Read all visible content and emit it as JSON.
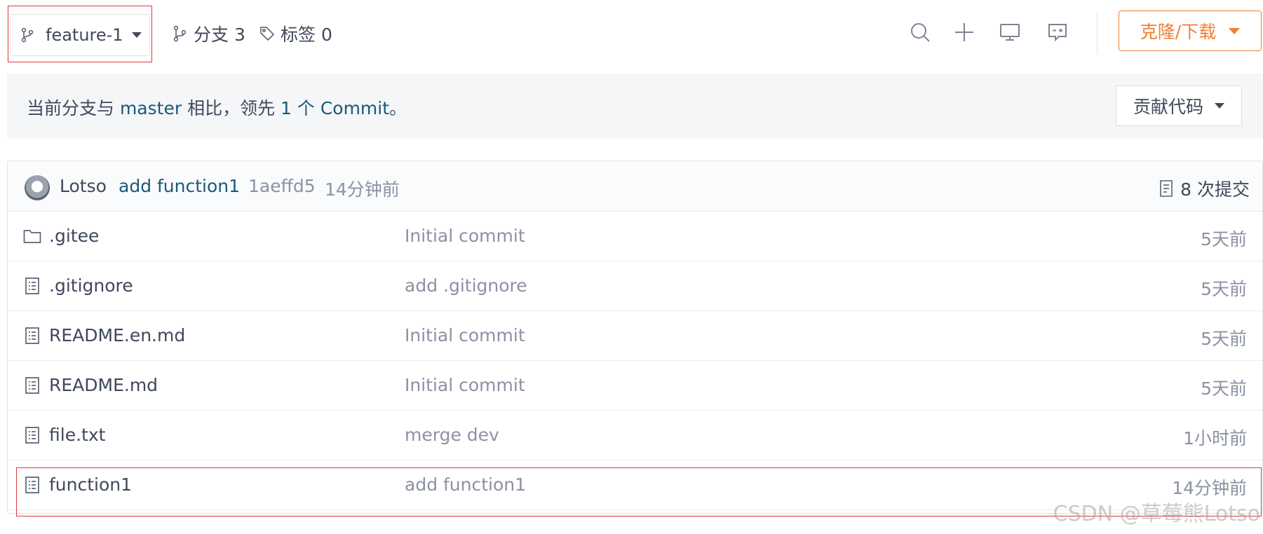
{
  "toolbar": {
    "branch_name": "feature-1",
    "branches_label": "分支 3",
    "tags_label": "标签 0",
    "icons": [
      "search-icon",
      "plus-icon",
      "monitor-icon",
      "comment-icon"
    ],
    "clone_label": "克隆/下载"
  },
  "compare": {
    "prefix": "当前分支与 ",
    "base_branch": "master",
    "middle": " 相比，领先 ",
    "ahead_count": "1 个 Commit",
    "suffix": "。",
    "contribute_label": "贡献代码"
  },
  "latest_commit": {
    "author": "Lotso",
    "message": "add function1",
    "sha": "1aeffd5",
    "time": "14分钟前",
    "count_label": "8 次提交"
  },
  "files": [
    {
      "name": ".gitee",
      "type": "folder",
      "message": "Initial commit",
      "time": "5天前"
    },
    {
      "name": ".gitignore",
      "type": "file",
      "message": "add .gitignore",
      "time": "5天前"
    },
    {
      "name": "README.en.md",
      "type": "file",
      "message": "Initial commit",
      "time": "5天前"
    },
    {
      "name": "README.md",
      "type": "file",
      "message": "Initial commit",
      "time": "5天前"
    },
    {
      "name": "file.txt",
      "type": "file",
      "message": "merge dev",
      "time": "1小时前"
    },
    {
      "name": "function1",
      "type": "file",
      "message": "add function1",
      "time": "14分钟前"
    }
  ],
  "watermark": "CSDN @草莓熊Lotso",
  "colors": {
    "accent_orange": "#f47d35",
    "link_blue": "#195a7a",
    "highlight_red": "#e0373c",
    "muted_text": "#8c92a4",
    "main_text": "#40485b"
  }
}
